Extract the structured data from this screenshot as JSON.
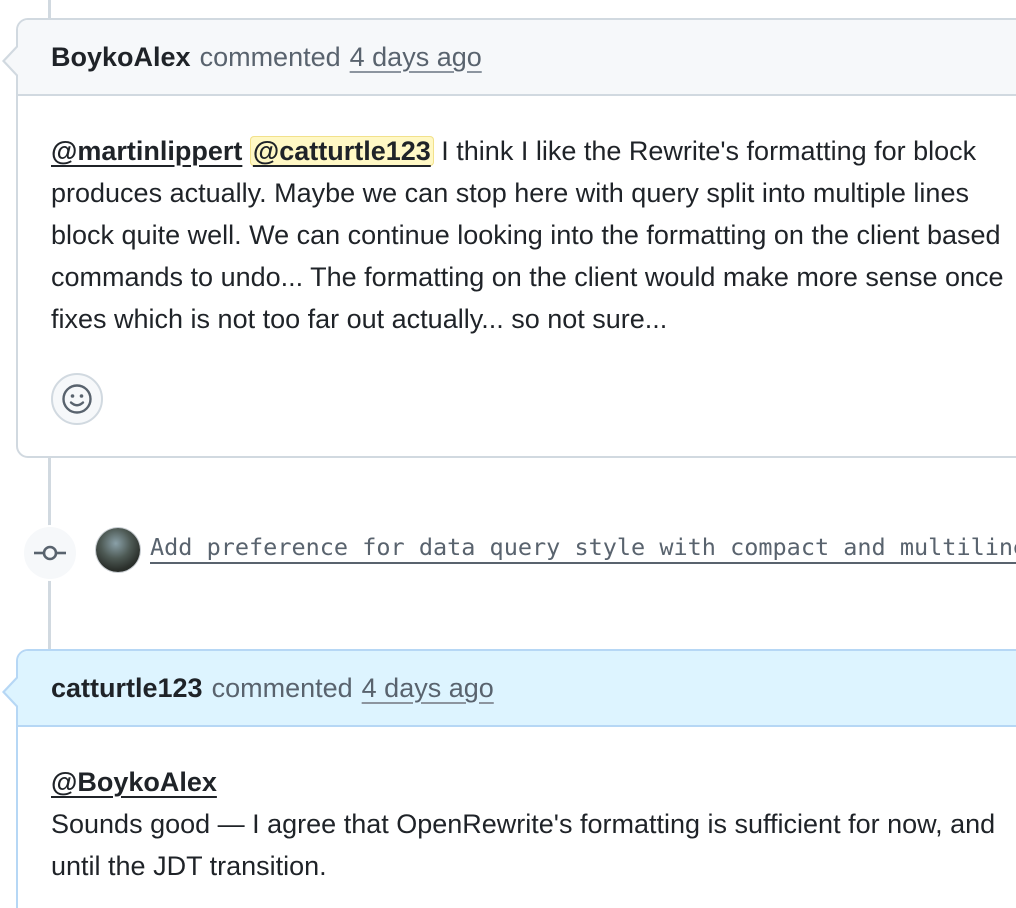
{
  "comments": [
    {
      "author": "BoykoAlex",
      "action": "commented",
      "time": "4 days ago",
      "mention1": "@martinlippert",
      "mention2": "@catturtle123",
      "line1_rest": " I think I like the Rewrite's formatting for block",
      "line2": "produces actually. Maybe we can stop here with query split into multiple lines",
      "line3": "block quite well. We can continue looking into the formatting on the client based",
      "line4": "commands to undo... The formatting on the client would make more sense once",
      "line5": "fixes which is not too far out actually... so not sure..."
    },
    {
      "author": "catturtle123",
      "action": "commented",
      "time": "4 days ago",
      "mention": "@BoykoAlex",
      "line1": "Sounds good — I agree that OpenRewrite's formatting is sufficient for now, and",
      "line2": "until the JDT transition."
    }
  ],
  "commit": {
    "message": "Add preference for data query style with compact and multiline",
    "icon": "git-commit-icon"
  },
  "reaction": {
    "icon": "smiley-icon"
  },
  "colors": {
    "border": "#d1d9e0",
    "header_bg": "#f6f8fa",
    "highlight_header_bg": "#ddf4ff",
    "mention_highlight": "#fff8c5"
  }
}
